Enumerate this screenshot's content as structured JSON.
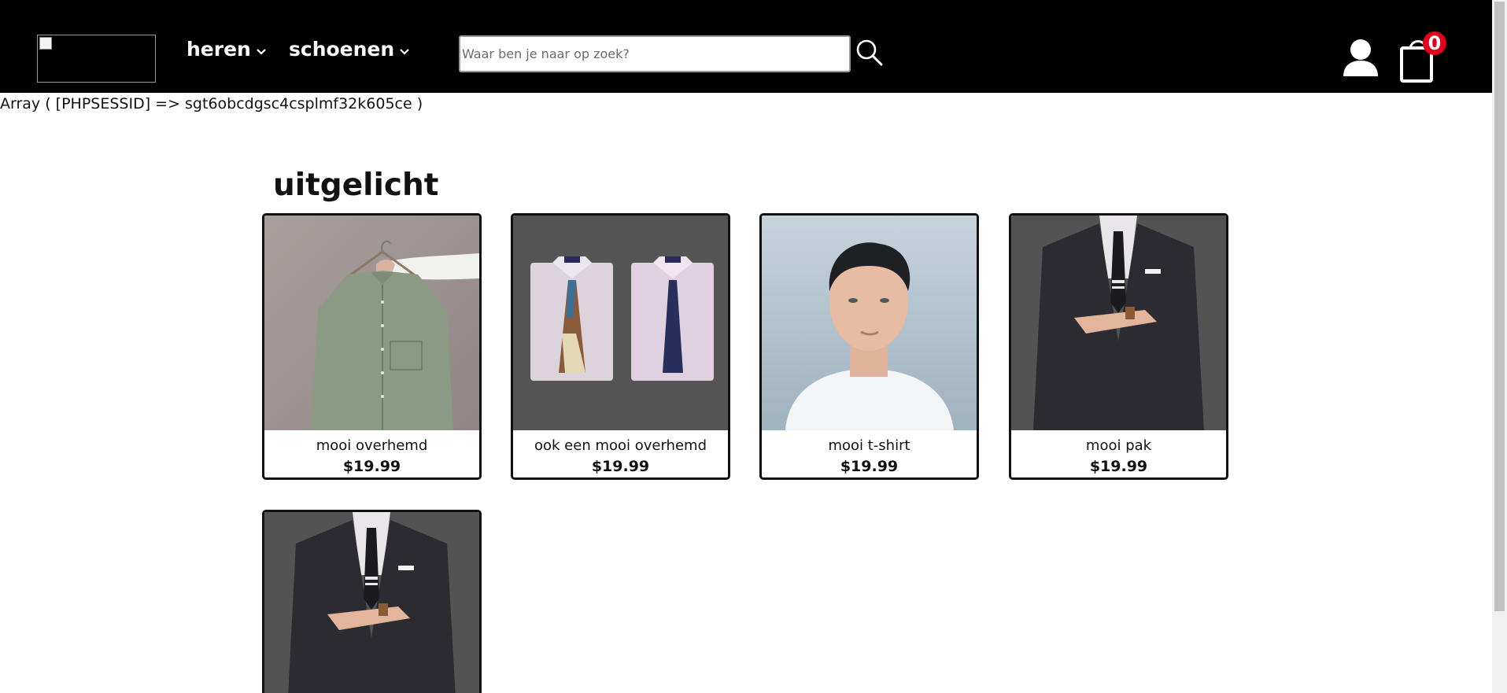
{
  "header": {
    "nav": [
      {
        "label": "heren"
      },
      {
        "label": "schoenen"
      }
    ],
    "search": {
      "placeholder": "Waar ben je naar op zoek?",
      "value": ""
    },
    "cart": {
      "count": "0"
    }
  },
  "debug_text": "Array ( [PHPSESSID] => sgt6obcdgsc4csplmf32k605ce )",
  "featured": {
    "title": "uitgelicht",
    "products": [
      {
        "name": "mooi overhemd",
        "price": "$19.99"
      },
      {
        "name": "ook een mooi overhemd",
        "price": "$19.99"
      },
      {
        "name": "mooi t-shirt",
        "price": "$19.99"
      },
      {
        "name": "mooi pak",
        "price": "$19.99"
      },
      {
        "name": "",
        "price": ""
      }
    ]
  },
  "colors": {
    "header_bg": "#000000",
    "badge": "#e0001b",
    "card_border": "#111111"
  },
  "icons": [
    "chevron-down-icon",
    "search-icon",
    "user-icon",
    "shopping-bag-icon",
    "broken-image-icon"
  ]
}
